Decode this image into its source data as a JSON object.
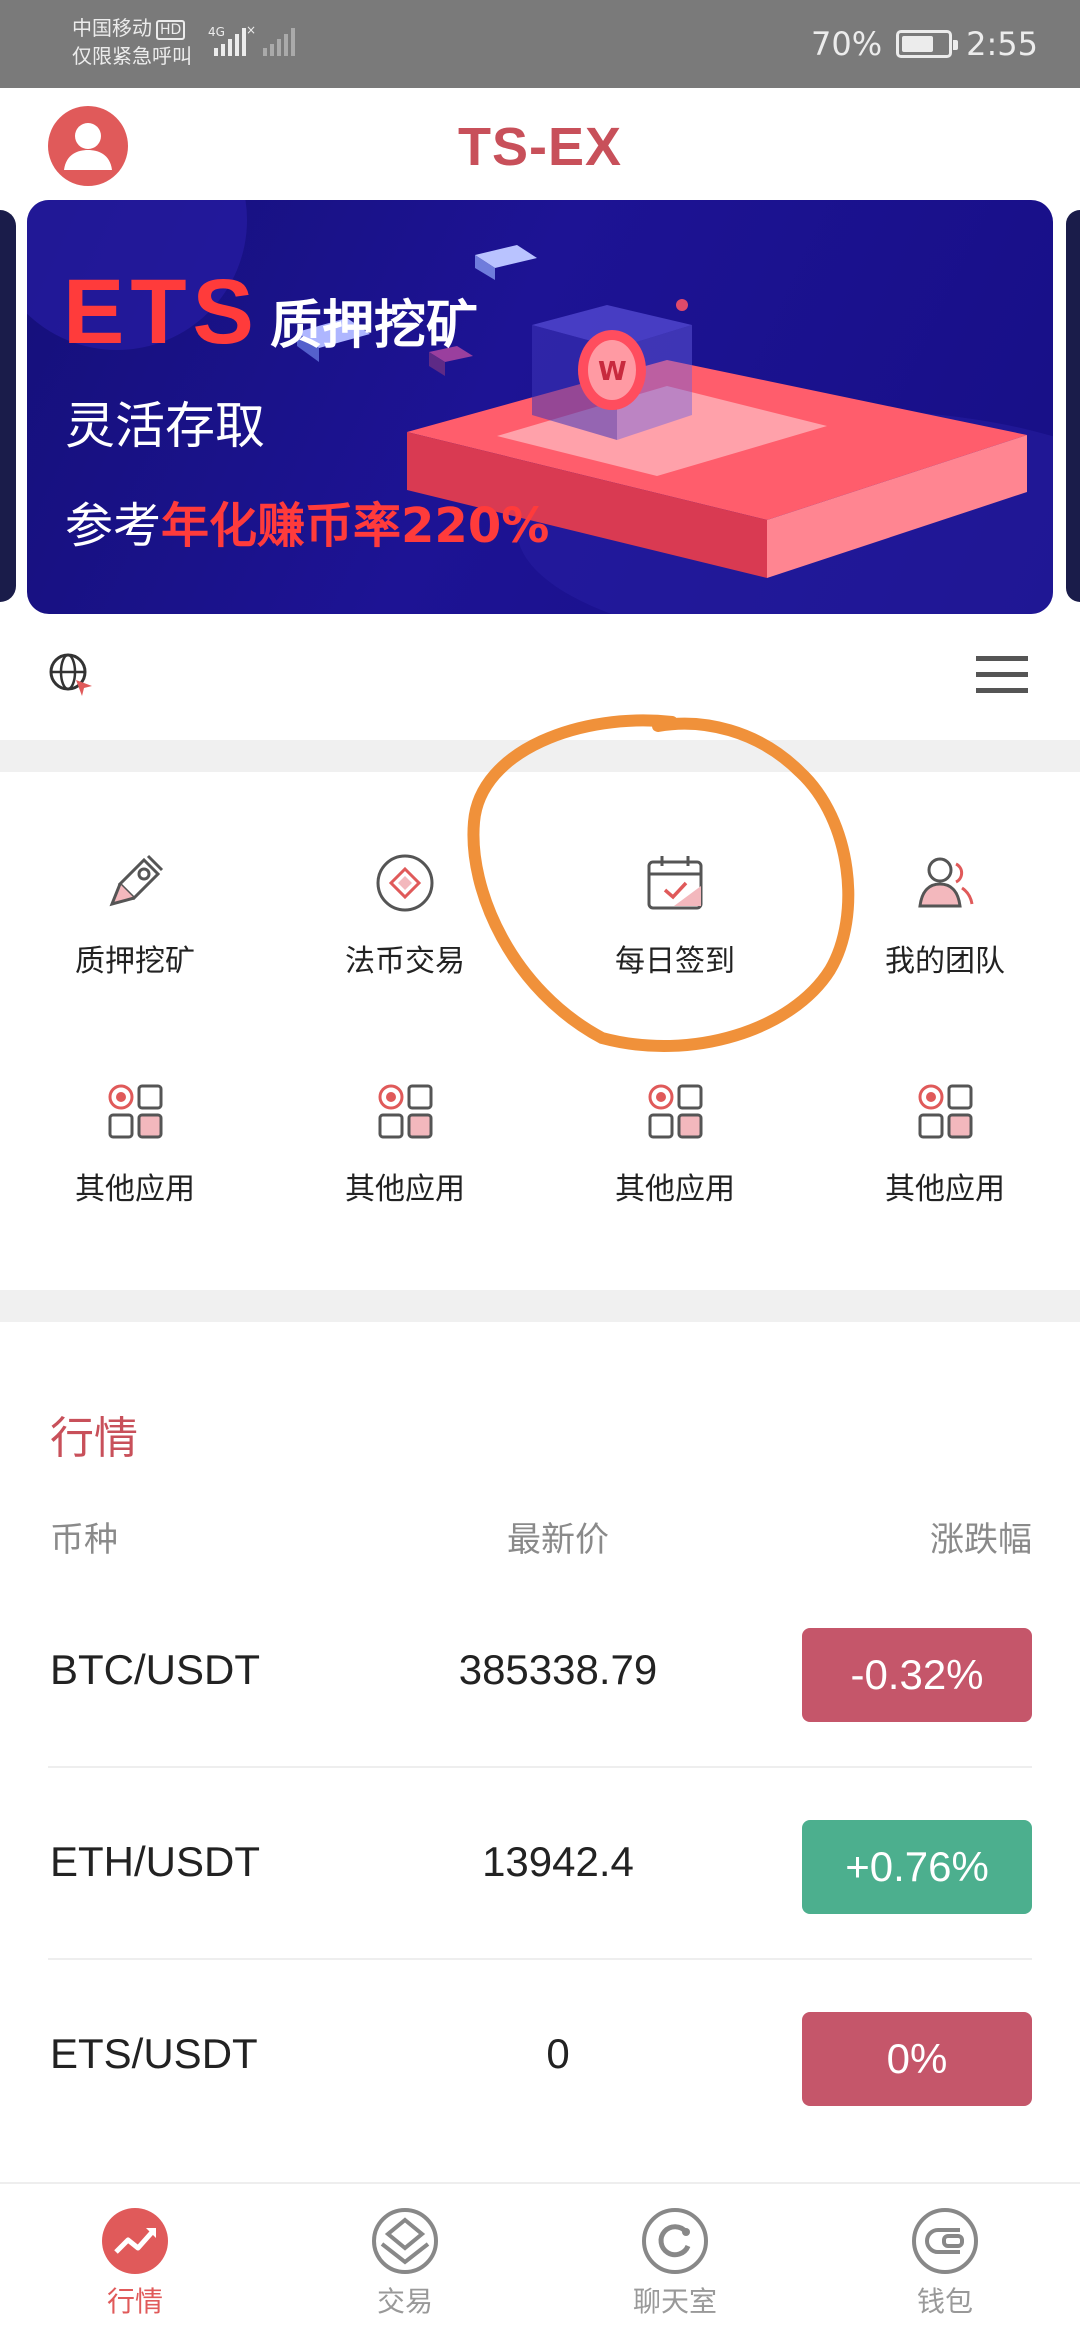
{
  "status_bar": {
    "carrier": "中国移动",
    "hd_badge": "HD",
    "network": "4G",
    "emergency": "仅限紧急呼叫",
    "battery": "70%",
    "battery_level": 0.7,
    "time": "2:55"
  },
  "header": {
    "title": "TS-EX"
  },
  "banner": {
    "brand": "ETS",
    "title": "质押挖矿",
    "line2": "灵活存取",
    "line3_prefix": "参考",
    "line3_highlight": "年化赚币率220%"
  },
  "grid": {
    "items": [
      {
        "label": "质押挖矿",
        "icon": "rocket-icon"
      },
      {
        "label": "法币交易",
        "icon": "exchange-icon"
      },
      {
        "label": "每日签到",
        "icon": "calendar-check-icon"
      },
      {
        "label": "我的团队",
        "icon": "team-icon"
      },
      {
        "label": "其他应用",
        "icon": "apps-icon"
      },
      {
        "label": "其他应用",
        "icon": "apps-icon"
      },
      {
        "label": "其他应用",
        "icon": "apps-icon"
      },
      {
        "label": "其他应用",
        "icon": "apps-icon"
      }
    ]
  },
  "market": {
    "title": "行情",
    "headers": {
      "pair": "币种",
      "price": "最新价",
      "change": "涨跌幅"
    },
    "rows": [
      {
        "pair": "BTC/USDT",
        "price": "385338.79",
        "change": "-0.32%",
        "trend": "down"
      },
      {
        "pair": "ETH/USDT",
        "price": "13942.4",
        "change": "+0.76%",
        "trend": "up"
      },
      {
        "pair": "ETS/USDT",
        "price": "0",
        "change": "0%",
        "trend": "down"
      }
    ]
  },
  "bottom_nav": {
    "items": [
      {
        "label": "行情",
        "icon": "trend-icon",
        "active": true
      },
      {
        "label": "交易",
        "icon": "trade-icon",
        "active": false
      },
      {
        "label": "聊天室",
        "icon": "chat-icon",
        "active": false
      },
      {
        "label": "钱包",
        "icon": "wallet-icon",
        "active": false
      }
    ]
  },
  "colors": {
    "brand": "#c8505a",
    "down": "#c5566a",
    "up": "#4caf8e",
    "annotation": "#f0913a"
  }
}
